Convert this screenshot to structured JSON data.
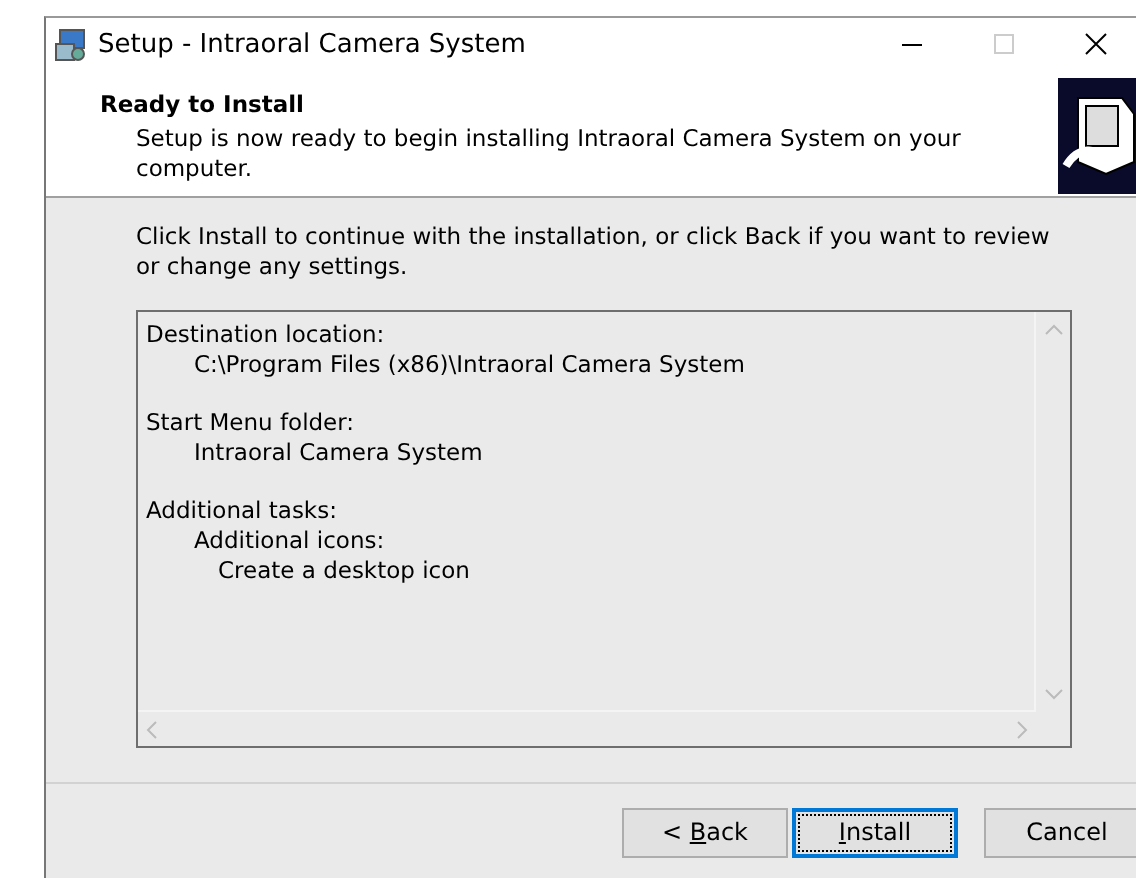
{
  "window": {
    "title": "Setup - Intraoral Camera System"
  },
  "header": {
    "title": "Ready to Install",
    "subtitle": "Setup is now ready to begin installing Intraoral Camera System on your computer."
  },
  "instruction": "Click Install to continue with the installation, or click Back if you want to review or change any settings.",
  "summary": [
    {
      "text": "Destination location:",
      "children": [
        {
          "text": "C:\\Program Files (x86)\\Intraoral Camera System"
        }
      ]
    },
    {
      "text": "Start Menu folder:",
      "children": [
        {
          "text": "Intraoral Camera System"
        }
      ]
    },
    {
      "text": "Additional tasks:",
      "children": [
        {
          "text": "Additional icons:",
          "children": [
            {
              "text": "Create a desktop icon"
            }
          ]
        }
      ]
    }
  ],
  "buttons": [
    {
      "label": [
        {
          "text": "< ",
          "underline": false
        },
        {
          "text": "B",
          "underline": true
        },
        {
          "text": "ack",
          "underline": false
        }
      ],
      "default": false
    },
    {
      "label": [
        {
          "text": "I",
          "underline": true
        },
        {
          "text": "nstall",
          "underline": false
        }
      ],
      "default": true
    },
    {
      "label": [
        {
          "text": "Cancel",
          "underline": false
        }
      ],
      "default": false
    }
  ]
}
